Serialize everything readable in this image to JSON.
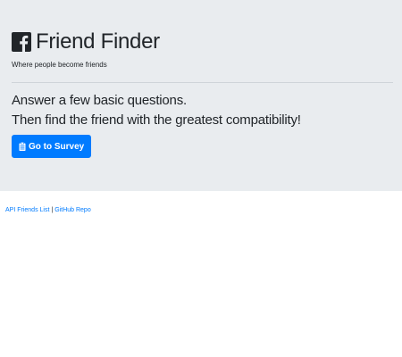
{
  "header": {
    "title": "Friend Finder",
    "tagline": "Where people become friends",
    "logo_icon": "facebook-square-icon"
  },
  "main": {
    "line1": "Answer a few basic questions.",
    "line2": "Then find the friend with the greatest compatibility!",
    "survey_button": {
      "label": "Go to Survey",
      "icon": "clipboard-icon"
    }
  },
  "footer": {
    "link1": "API Friends List",
    "separator": "|",
    "link2": "GitHub Repo"
  },
  "colors": {
    "jumbotron_bg": "#e9ecef",
    "primary": "#007bff",
    "text": "#212529"
  }
}
